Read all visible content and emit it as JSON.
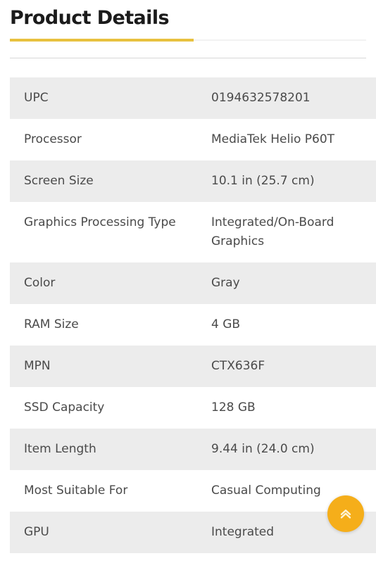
{
  "header": {
    "title": "Product Details",
    "accent_color": "#e8c13f",
    "title_color": "#1b1b1b"
  },
  "spec_table": {
    "shaded_row_color": "#ececec",
    "text_color": "#4a4a4a",
    "rows": [
      {
        "label": "UPC",
        "value": "0194632578201"
      },
      {
        "label": "Processor",
        "value": "MediaTek Helio P60T"
      },
      {
        "label": "Screen Size",
        "value": "10.1 in (25.7 cm)"
      },
      {
        "label": "Graphics Processing Type",
        "value": "Integrated/On-Board Graphics"
      },
      {
        "label": "Color",
        "value": "Gray"
      },
      {
        "label": "RAM Size",
        "value": "4 GB"
      },
      {
        "label": "MPN",
        "value": "CTX636F"
      },
      {
        "label": "SSD Capacity",
        "value": "128 GB"
      },
      {
        "label": "Item Length",
        "value": "9.44 in (24.0 cm)"
      },
      {
        "label": "Most Suitable For",
        "value": "Casual Computing"
      },
      {
        "label": "GPU",
        "value": "Integrated"
      }
    ]
  },
  "scroll_top_button": {
    "icon": "double-chevron-up-icon",
    "background_color": "#f5ae1a",
    "icon_color": "#fdf3d8"
  }
}
